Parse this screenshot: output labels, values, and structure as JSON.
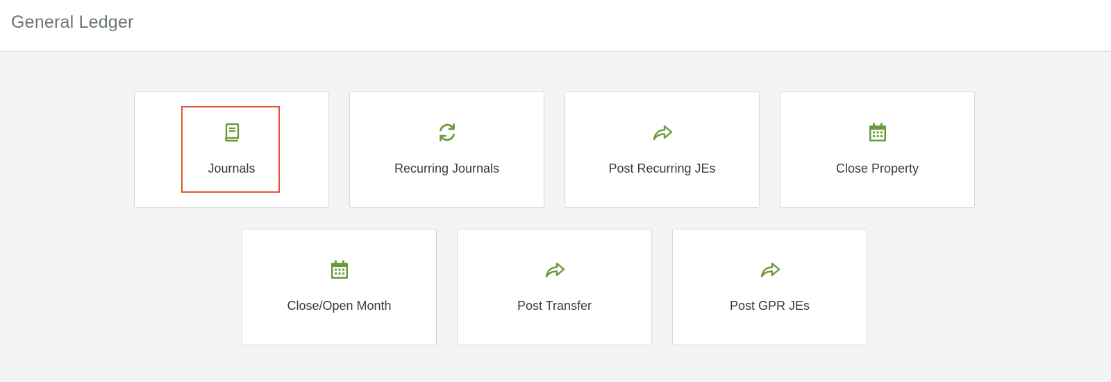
{
  "header": {
    "title": "General Ledger"
  },
  "accent_color": "#6a9a3a",
  "focus_color": "#e25532",
  "tiles": [
    {
      "label": "Journals",
      "icon": "book-icon"
    },
    {
      "label": "Recurring Journals",
      "icon": "refresh-icon"
    },
    {
      "label": "Post Recurring JEs",
      "icon": "share-arrow-icon"
    },
    {
      "label": "Close Property",
      "icon": "calendar-icon"
    },
    {
      "label": "Close/Open Month",
      "icon": "calendar-icon"
    },
    {
      "label": "Post Transfer",
      "icon": "share-arrow-icon"
    },
    {
      "label": "Post GPR JEs",
      "icon": "share-arrow-icon"
    }
  ]
}
